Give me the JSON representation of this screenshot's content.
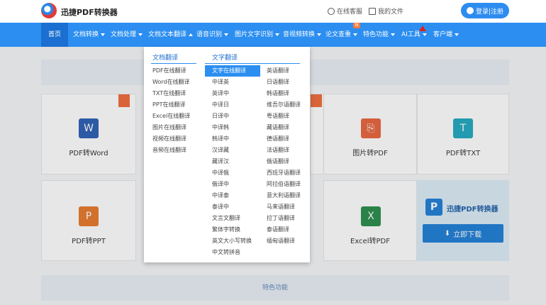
{
  "header": {
    "brand": "迅捷PDF转换器",
    "service": "在线客服",
    "my_docs": "我的文件",
    "login": "登录|注册"
  },
  "nav": [
    {
      "label": "首页"
    },
    {
      "label": "文档转换"
    },
    {
      "label": "文档处理"
    },
    {
      "label": "文档文本翻译"
    },
    {
      "label": "语音识别"
    },
    {
      "label": "图片文字识别"
    },
    {
      "label": "音视频转换"
    },
    {
      "label": "论文查重"
    },
    {
      "label": "特色功能"
    },
    {
      "label": "AI工具"
    },
    {
      "label": "客户端"
    }
  ],
  "nav_badge": "热",
  "dropdown": {
    "col1_title": "文档翻译",
    "col1": [
      "PDF在线翻译",
      "Word在线翻译",
      "TXT在线翻译",
      "PPT在线翻译",
      "Excel在线翻译",
      "图片在线翻译",
      "视频在线翻译",
      "音频在线翻译"
    ],
    "col2_title": "文字翻译",
    "col2": [
      "文字在线翻译",
      "中译英",
      "英译中",
      "中译日",
      "日译中",
      "中译韩",
      "韩译中",
      "汉译藏",
      "藏译汉",
      "中译俄",
      "俄译中",
      "中译泰",
      "泰译中",
      "文言文翻译",
      "繁体字转换",
      "英文大小写转换",
      "中文转拼音"
    ],
    "col3": [
      "英语翻译",
      "日语翻译",
      "韩语翻译",
      "维吾尔语翻译",
      "粤语翻译",
      "藏语翻译",
      "德语翻译",
      "法语翻译",
      "俄语翻译",
      "西班牙语翻译",
      "阿拉伯语翻译",
      "意大利语翻译",
      "马来语翻译",
      "拉丁语翻译",
      "泰语翻译",
      "缅甸语翻译"
    ]
  },
  "cards": [
    {
      "label": "PDF转Word",
      "icon": "W",
      "color": "#2b5fb4"
    },
    {
      "label": "图片转PDF",
      "icon": "pdf-icon",
      "color": "#e8643c"
    },
    {
      "label": "PDF转TXT",
      "icon": "T",
      "color": "#20a8c0"
    },
    {
      "label": "PDF转PPT",
      "icon": "P",
      "color": "#e8782c"
    },
    {
      "label": "Excel转PDF",
      "icon": "X",
      "color": "#2a8c4a"
    }
  ],
  "download": {
    "brand": "迅捷PDF转换器",
    "button": "立即下载"
  },
  "feature_bar": "特色功能"
}
